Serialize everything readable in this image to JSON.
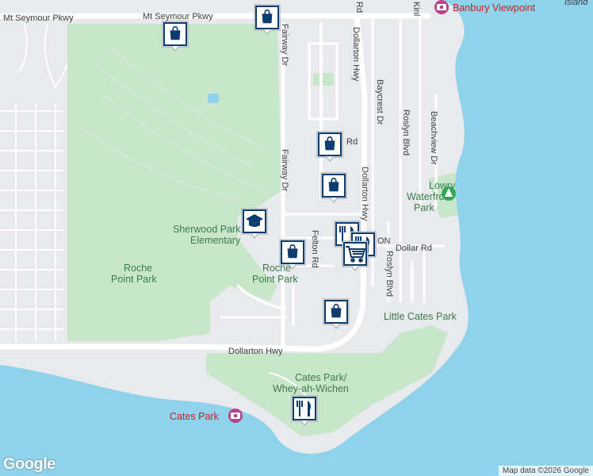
{
  "map": {
    "labels": {
      "mt_seymour_pkwy_left": "Mt Seymour Pkwy",
      "mt_seymour_pkwy_center": "Mt Seymour Pkwy",
      "fairway_dr_top": "Fairway Dr",
      "fairway_dr_mid": "Fairway Dr",
      "dollarton_hwy_top": "Dollarton Hwy",
      "dollarton_hwy_mid": "Dollarton Hwy",
      "dollarton_hwy_bottom": "Dollarton Hwy",
      "baycrest_dr": "Baycrest Dr",
      "roslyn_blvd_top": "Roslyn Blvd",
      "roslyn_blvd_bottom": "Roslyn Blvd",
      "beachview_dr": "Beachview Dr",
      "felton_rd": "Felton Rd",
      "dollar_rd": "Dollar Rd",
      "rd_fragment": "Rd",
      "rd_fragment_top": "Rd",
      "on_fragment": "ON",
      "kinl_fragment": "Kinl",
      "island_fragment": "Island"
    },
    "places": {
      "banbury_viewpoint": "Banbury Viewpoint",
      "lowry_waterfront_park_1": "Lowry",
      "lowry_waterfront_park_2": "Waterfront",
      "lowry_waterfront_park_3": "Park",
      "sherwood_park_elementary_1": "Sherwood Park",
      "sherwood_park_elementary_2": "Elementary",
      "roche_point_park_west_1": "Roche",
      "roche_point_park_west_2": "Point Park",
      "roche_point_park_east_1": "Roche",
      "roche_point_park_east_2": "Point Park",
      "little_cates_park": "Little Cates Park",
      "cates_park_whey_ah_wichen_1": "Cates Park/",
      "cates_park_whey_ah_wichen_2": "Whey-ah-Wichen",
      "cates_park": "Cates Park"
    },
    "markers": [
      {
        "id": "shopping-1",
        "icon": "shopping-bag-icon"
      },
      {
        "id": "shopping-2",
        "icon": "shopping-bag-icon"
      },
      {
        "id": "shopping-3",
        "icon": "shopping-bag-icon"
      },
      {
        "id": "shopping-4",
        "icon": "shopping-bag-icon"
      },
      {
        "id": "shopping-5",
        "icon": "shopping-bag-icon"
      },
      {
        "id": "shopping-6",
        "icon": "shopping-bag-icon"
      },
      {
        "id": "school-1",
        "icon": "graduation-cap-icon"
      },
      {
        "id": "restaurant-1",
        "icon": "fork-knife-icon"
      },
      {
        "id": "restaurant-2",
        "icon": "fork-knife-icon"
      },
      {
        "id": "restaurant-3",
        "icon": "fork-knife-icon"
      },
      {
        "id": "grocery-1",
        "icon": "shopping-cart-icon"
      }
    ],
    "colors": {
      "water": "#8fd2ec",
      "park": "#c8e6c9",
      "land": "#e8eaed",
      "road": "#ffffff",
      "marker": "#0d3d6e"
    }
  },
  "footer": {
    "logo": "Google",
    "attribution": "Map data ©2026 Google"
  }
}
